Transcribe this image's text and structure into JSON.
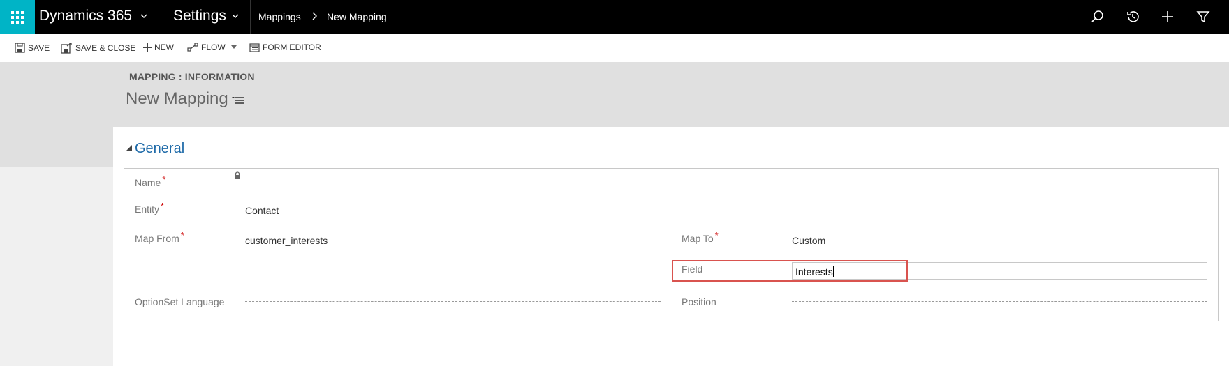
{
  "topbar": {
    "app_name": "Dynamics 365",
    "area": "Settings",
    "breadcrumb": [
      "Mappings",
      "New Mapping"
    ],
    "icons": [
      "app-launcher-icon",
      "chevron-down-icon",
      "search-icon",
      "history-icon",
      "plus-icon",
      "filter-icon"
    ],
    "accent_color": "#00b4c6"
  },
  "commandbar": {
    "save": "SAVE",
    "save_close": "SAVE & CLOSE",
    "new": "NEW",
    "flow": "FLOW",
    "form_editor": "FORM EDITOR"
  },
  "header": {
    "form_type": "MAPPING : INFORMATION",
    "title": "New Mapping"
  },
  "section": {
    "title": "General",
    "fields": {
      "name_label": "Name",
      "entity_label": "Entity",
      "entity_value": "Contact",
      "map_from_label": "Map From",
      "map_from_value": "customer_interests",
      "map_to_label": "Map To",
      "map_to_value": "Custom",
      "field_label": "Field",
      "field_value": "Interests",
      "optionset_label": "OptionSet Language",
      "position_label": "Position"
    },
    "required_marker": "*"
  }
}
